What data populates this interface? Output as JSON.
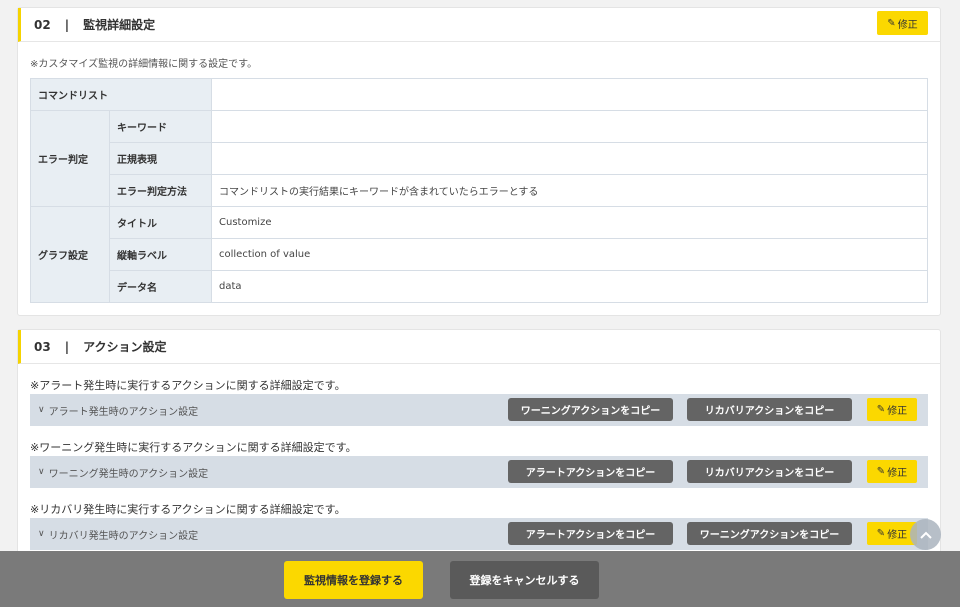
{
  "section2": {
    "number": "02",
    "separator": "|",
    "title": "監視詳細設定",
    "edit_label": "修正",
    "note": "※カスタマイズ監視の詳細情報に関する設定です。",
    "table": {
      "command_list_label": "コマンドリスト",
      "command_list_value": "",
      "error_group_label": "エラー判定",
      "keyword_label": "キーワード",
      "keyword_value": "",
      "regex_label": "正規表現",
      "regex_value": "",
      "method_label": "エラー判定方法",
      "method_value": "コマンドリストの実行結果にキーワードが含まれていたらエラーとする",
      "graph_group_label": "グラフ設定",
      "graph_title_label": "タイトル",
      "graph_title_value": "Customize",
      "vaxis_label": "縦軸ラベル",
      "vaxis_value": "collection of value",
      "data_name_label": "データ名",
      "data_name_value": "data"
    }
  },
  "section3": {
    "number": "03",
    "separator": "|",
    "title": "アクション設定",
    "alert": {
      "note": "※アラート発生時に実行するアクションに関する詳細設定です。",
      "label": "アラート発生時のアクション設定",
      "copy1": "ワーニングアクションをコピー",
      "copy2": "リカバリアクションをコピー",
      "edit": "修正"
    },
    "warning": {
      "note": "※ワーニング発生時に実行するアクションに関する詳細設定です。",
      "label": "ワーニング発生時のアクション設定",
      "copy1": "アラートアクションをコピー",
      "copy2": "リカバリアクションをコピー",
      "edit": "修正"
    },
    "recovery": {
      "note": "※リカバリ発生時に実行するアクションに関する詳細設定です。",
      "label": "リカバリ発生時のアクション設定",
      "copy1": "アラートアクションをコピー",
      "copy2": "ワーニングアクションをコピー",
      "edit": "修正"
    }
  },
  "footer": {
    "register_label": "監視情報を登録する",
    "cancel_label": "登録をキャンセルする"
  },
  "icons": {
    "pencil": "pencil-icon",
    "chevron": "chevron-down-icon",
    "scroll_top": "chevron-up-icon"
  },
  "colors": {
    "accent": "#fbd800",
    "dark_button": "#646464",
    "row_bg": "#d6dde5",
    "header_cell_bg": "#e8eef3"
  }
}
